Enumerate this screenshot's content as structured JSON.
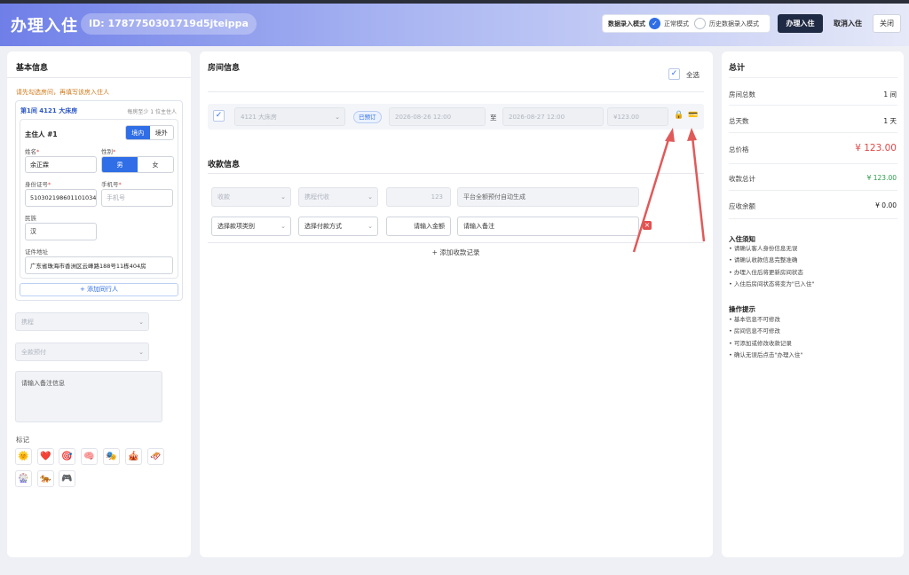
{
  "header": {
    "title": "办理入住",
    "id_label": "ID: 1787750301719d5jteippa",
    "mode_label": "数据录入模式",
    "mode_normal": "正常模式",
    "mode_history": "历史数据录入模式",
    "checkin_button": "办理入住",
    "cancel_button": "取消入住",
    "close_button": "关闭"
  },
  "basic": {
    "title": "基本信息",
    "hint": "请先勾选房间，再填写该房入住人",
    "room_header": "第1间 4121 大床房",
    "room_requirement": "每房至少 1 位主住人",
    "guest_title": "主住人 #1",
    "region_domestic": "境内",
    "region_foreign": "境外",
    "name_label": "姓名",
    "name_value": "余正霖",
    "gender_label": "性别",
    "gender_male": "男",
    "gender_female": "女",
    "id_label": "身份证号",
    "id_value": "510302198601101034",
    "phone_label": "手机号",
    "phone_placeholder": "手机号",
    "ethnic_label": "民族",
    "ethnic_value": "汉",
    "address_label": "证件地址",
    "address_value": "广东省珠海市香洲区云峰路188号11栋404房",
    "add_companion": "+ 添加同行人",
    "channel_select": "携程",
    "payment_select": "全款预付",
    "remark_placeholder": "请输入备注信息",
    "tags_label": "标记",
    "tags": [
      "🌞",
      "❤️",
      "🎯",
      "🧠",
      "🎭",
      "🎪",
      "🛷",
      "🎡",
      "🐅",
      "🎮"
    ]
  },
  "rooms": {
    "title": "房间信息",
    "select_all": "全选",
    "room_select": "4121 大床房",
    "status_badge": "已预订",
    "checkin_date": "2026-08-26 12:00",
    "to_label": "至",
    "checkout_date": "2026-08-27 12:00",
    "price": "¥123.00",
    "lock_icon": "🔒",
    "card_icon": "💳"
  },
  "payments": {
    "title": "收款信息",
    "row1": {
      "type": "收款",
      "method": "携程代收",
      "amount": "123",
      "remark": "平台全额预付自动生成"
    },
    "row2": {
      "type_placeholder": "选择款项类别",
      "method_placeholder": "选择付款方式",
      "amount_placeholder": "请输入金额",
      "remark_placeholder": "请输入备注",
      "remove": "×"
    },
    "add_payment": "+ 添加收款记录"
  },
  "summary": {
    "title": "总计",
    "rooms_label": "房间总数",
    "rooms_value": "1 间",
    "days_label": "总天数",
    "days_value": "1 天",
    "price_label": "总价格",
    "price_value": "¥ 123.00",
    "received_label": "收款总计",
    "received_value": "¥ 123.00",
    "balance_label": "应收余额",
    "balance_value": "¥ 0.00",
    "notice_title": "入住须知",
    "notices": [
      "• 请确认客人身份信息无误",
      "• 请确认收款信息完整准确",
      "• 办理入住后将更新房间状态",
      "• 入住后房间状态将变为\"已入住\""
    ],
    "tips_title": "操作提示",
    "tips": [
      "• 基本信息不可修改",
      "• 房间信息不可修改",
      "• 可添加或修改收款记录",
      "• 确认无误后点击\"办理入住\""
    ]
  },
  "colors": {
    "accent": "#2f6ee6",
    "price_red": "#e04848",
    "received_green": "#2a9d4a",
    "warning_orange": "#d07a1a"
  }
}
